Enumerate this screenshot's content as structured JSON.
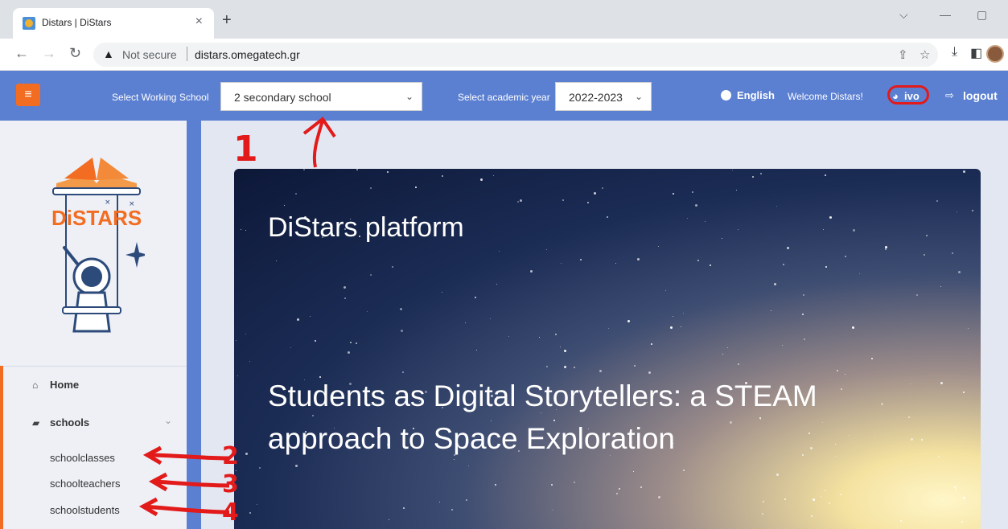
{
  "browser": {
    "tab_title": "Distars | DiStars",
    "tab_close": "×",
    "new_tab": "+",
    "security_label": "Not secure",
    "url": "distars.omegatech.gr"
  },
  "header": {
    "menu_icon": "≡",
    "working_school_label": "Select Working School",
    "working_school_value": "2 secondary school",
    "academic_year_label": "Select academic year",
    "academic_year_value": "2022-2023",
    "language": "English",
    "welcome": "Welcome Distars!",
    "user": "ivo",
    "logout": "logout"
  },
  "sidebar": {
    "logo_text": "DiSTARS",
    "items": [
      {
        "label": "Home",
        "icon": "home-icon"
      },
      {
        "label": "schools",
        "icon": "book-icon"
      }
    ],
    "sub_items": [
      "schoolclasses",
      "schoolteachers",
      "schoolstudents"
    ]
  },
  "hero": {
    "title": "DiStars platform",
    "subtitle": "Students as Digital Storytellers: a STEAM approach to Space Exploration"
  },
  "annotations": [
    "1",
    "2",
    "3",
    "4"
  ],
  "colors": {
    "header_blue": "#5b7fd1",
    "accent_orange": "#f26d21",
    "annotation_red": "#e31a1a"
  }
}
